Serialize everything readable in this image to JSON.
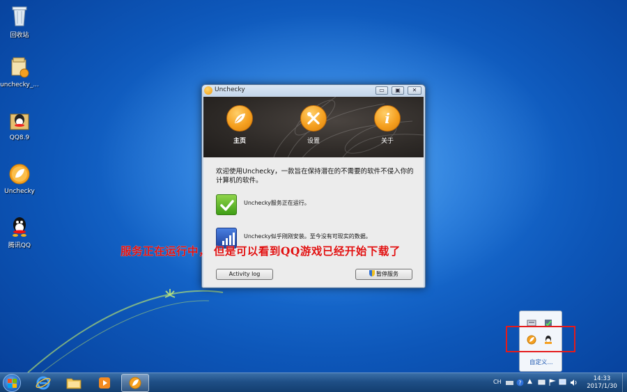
{
  "desktop": {
    "icons": [
      {
        "label": "回收站",
        "icon": "recycle-bin-icon"
      },
      {
        "label": "unchecky_...",
        "icon": "installer-icon"
      },
      {
        "label": "QQ8.9",
        "icon": "qq-installer-icon"
      },
      {
        "label": "Unchecky",
        "icon": "unchecky-icon"
      },
      {
        "label": "腾讯QQ",
        "icon": "qq-penguin-icon"
      }
    ]
  },
  "window": {
    "title": "Unchecky",
    "controls": {
      "minimize": "▭",
      "maximize": "▣",
      "close": "✕"
    },
    "nav": [
      {
        "label": "主页",
        "icon": "leaf-icon",
        "active": true
      },
      {
        "label": "设置",
        "icon": "tools-icon",
        "active": false
      },
      {
        "label": "关于",
        "icon": "info-icon",
        "active": false
      }
    ],
    "intro": "欢迎使用Unchecky，一款旨在保持潜在的不需要的软件不侵入你的计算机的软件。",
    "status_service": "Unchecky服务正在运行。",
    "status_installs": "Unchecky似乎刚刚安装。至今没有可现实的数据。",
    "activity_log": "Activity log",
    "pause_service": "暂停服务"
  },
  "annotation": "服务正在运行中， 但是可以看到QQ游戏已经开始下载了",
  "tray_popup": {
    "customize": "自定义..."
  },
  "taskbar": {
    "lang": "CH",
    "time": "14:33",
    "date": "2017/1/30"
  },
  "colors": {
    "desktop": "#1a6fd4",
    "accent_orange": "#f5a020",
    "annotation_red": "#e01010",
    "highlight_box": "#e41b1b"
  }
}
